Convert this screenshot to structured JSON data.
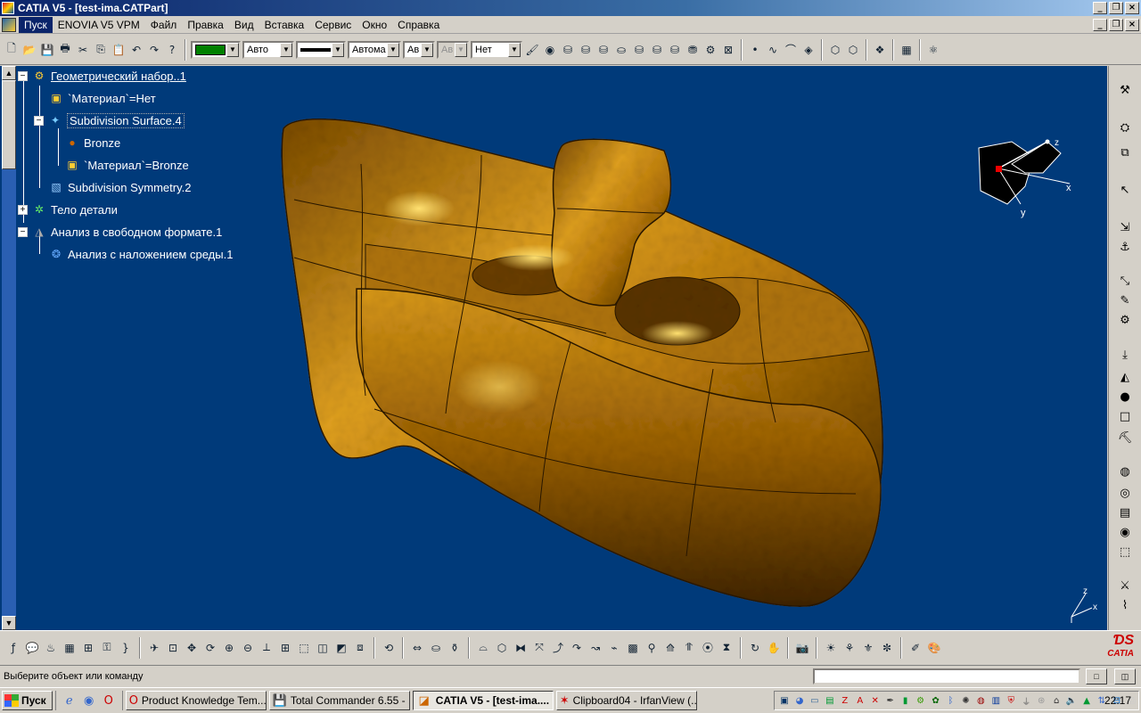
{
  "window": {
    "title": "CATIA V5 - [test-ima.CATPart]"
  },
  "menu": {
    "items": [
      "Пуск",
      "ENOVIA V5 VPM",
      "Файл",
      "Правка",
      "Вид",
      "Вставка",
      "Сервис",
      "Окно",
      "Справка"
    ],
    "active_index": 0
  },
  "toolbar_top": {
    "color_swatch": "#008000",
    "combo_color_mode": "Авто",
    "combo_linetype_mode": "Автома",
    "combo_weight": "Ав",
    "combo_weight_disabled": "Ав",
    "combo_layer": "Нет",
    "line_color": "#000000"
  },
  "tree": {
    "root": "Геометрический набор..1",
    "material_1": "`Материал`=Нет",
    "subdivision_surface": "Subdivision Surface.4",
    "bronze": "Bronze",
    "material_2": "`Материал`=Bronze",
    "subdivision_symmetry": "Subdivision Symmetry.2",
    "part_body": "Тело детали",
    "freestyle_analysis": "Анализ в свободном формате.1",
    "environment_mapping": "Анализ с наложением среды.1"
  },
  "compass": {
    "x_label": "x",
    "y_label": "y",
    "z_label": "z"
  },
  "axes_indicator": {
    "x_label": "x",
    "z_label": "z"
  },
  "viewport": {
    "background": "#003a7a",
    "model_color": "#c48a10"
  },
  "status": {
    "message": "Выберите объект или команду"
  },
  "taskbar": {
    "start": "Пуск",
    "tasks": [
      {
        "label": "Product Knowledge Tem...",
        "icon": "opera-icon",
        "active": false
      },
      {
        "label": "Total Commander 6.55 - ...",
        "icon": "floppy-icon",
        "active": false
      },
      {
        "label": "CATIA V5 - [test-ima....",
        "icon": "catia-icon",
        "active": true
      },
      {
        "label": "Clipboard04 - IrfanView (...",
        "icon": "irfanview-icon",
        "active": false
      }
    ],
    "clock": "22:17"
  },
  "brand": {
    "logo_text": "CATIA"
  }
}
